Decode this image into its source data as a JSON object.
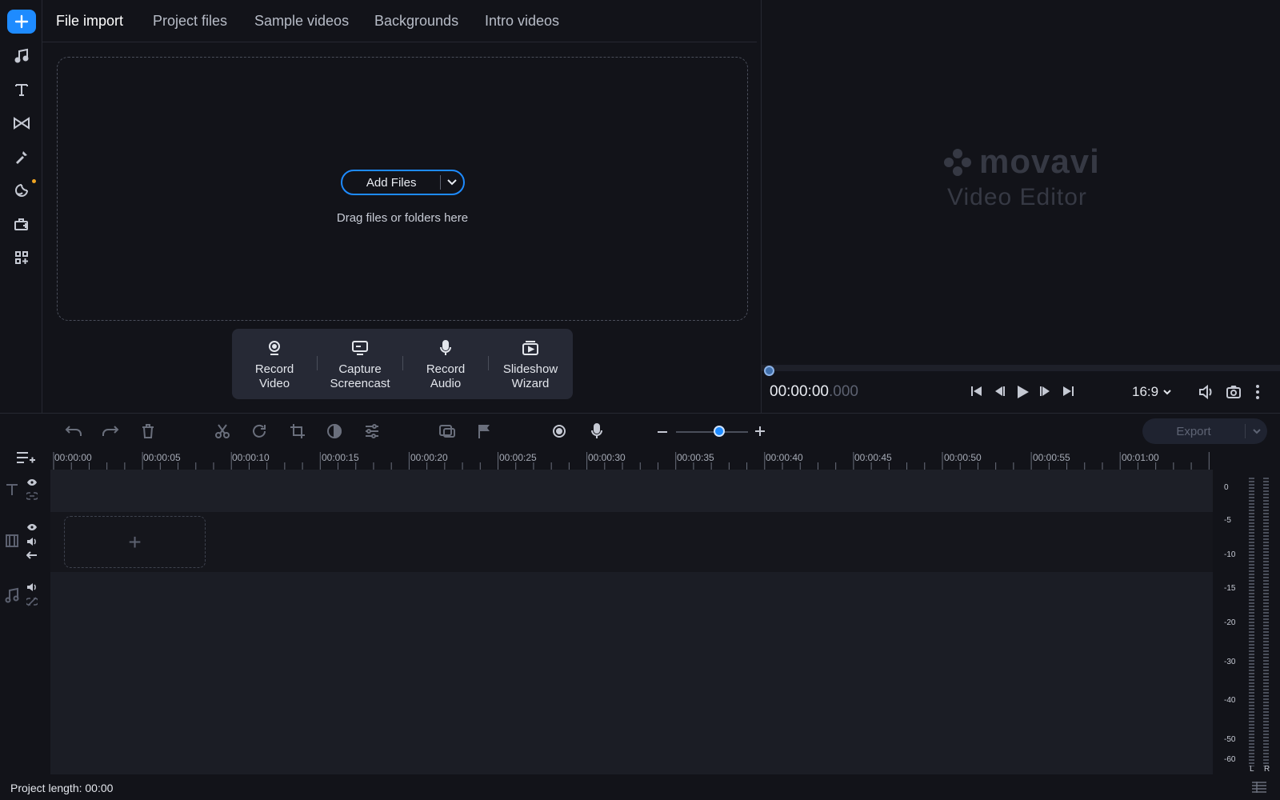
{
  "colors": {
    "accent": "#1e8bff",
    "background": "#121319",
    "panel": "#262935"
  },
  "import_tabs": [
    "File import",
    "Project files",
    "Sample videos",
    "Backgrounds",
    "Intro videos"
  ],
  "sidebar": {
    "icons": [
      "plus-icon",
      "music-note-icon",
      "text-icon",
      "transitions-icon",
      "magic-wand-icon",
      "stickers-icon",
      "store-icon",
      "more-tools-icon"
    ]
  },
  "import": {
    "add_files_label": "Add Files",
    "drag_hint": "Drag files or folders here"
  },
  "capture_tools": [
    {
      "line1": "Record",
      "line2": "Video",
      "icon": "webcam-icon"
    },
    {
      "line1": "Capture",
      "line2": "Screencast",
      "icon": "screen-capture-icon"
    },
    {
      "line1": "Record",
      "line2": "Audio",
      "icon": "microphone-icon"
    },
    {
      "line1": "Slideshow",
      "line2": "Wizard",
      "icon": "slideshow-icon"
    }
  ],
  "preview": {
    "brand": "movavi",
    "product": "Video Editor",
    "timecode_main": "00:00:00",
    "timecode_ms": ".000",
    "aspect_ratio": "16:9"
  },
  "toolbar": {
    "export_label": "Export"
  },
  "ruler": {
    "labels": [
      "00:00:00",
      "00:00:05",
      "00:00:10",
      "00:00:15",
      "00:00:20",
      "00:00:25",
      "00:00:30",
      "00:00:35",
      "00:00:40",
      "00:00:45",
      "00:00:50",
      "00:00:55",
      "00:01:00"
    ]
  },
  "meter": {
    "db_labels": [
      "0",
      "-5",
      "-10",
      "-15",
      "-20",
      "-30",
      "-40",
      "-50",
      "-60"
    ],
    "channels": [
      "L",
      "R"
    ]
  },
  "status": {
    "project_length": "Project length: 00:00"
  }
}
